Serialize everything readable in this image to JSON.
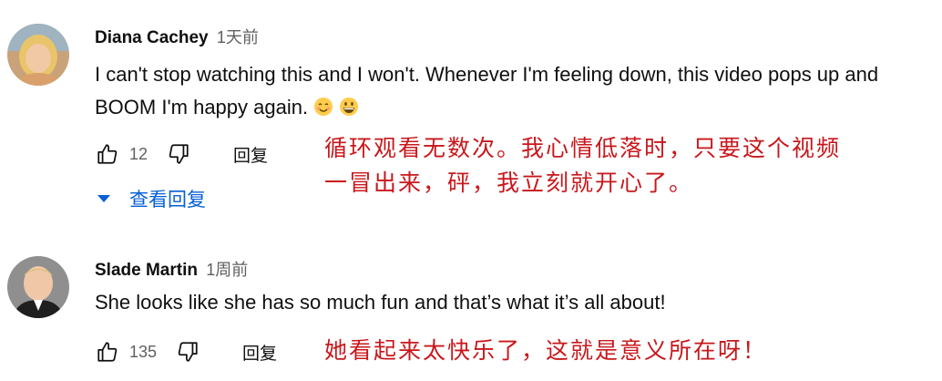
{
  "comments": [
    {
      "author": "Diana Cachey",
      "time": "1天前",
      "text": "I can't stop watching this and I won't. Whenever I'm feeling down, this video pops up and BOOM I'm happy again.",
      "emojis": [
        "smiling-face-icon",
        "grinning-face-icon"
      ],
      "likes": "12",
      "reply_label": "回复",
      "view_replies_label": "查看回复",
      "translation": [
        "循环观看无数次。我心情低落时，只要这个视频",
        "一冒出来，砰，我立刻就开心了。"
      ]
    },
    {
      "author": "Slade Martin",
      "time": "1周前",
      "text": "She looks like she has so much fun and that’s what it’s all about!",
      "likes": "135",
      "reply_label": "回复",
      "translation": [
        "她看起来太快乐了，这就是意义所在呀！"
      ]
    }
  ],
  "colors": {
    "link": "#065fd4",
    "annotation": "#c8181c",
    "meta": "#606060"
  }
}
